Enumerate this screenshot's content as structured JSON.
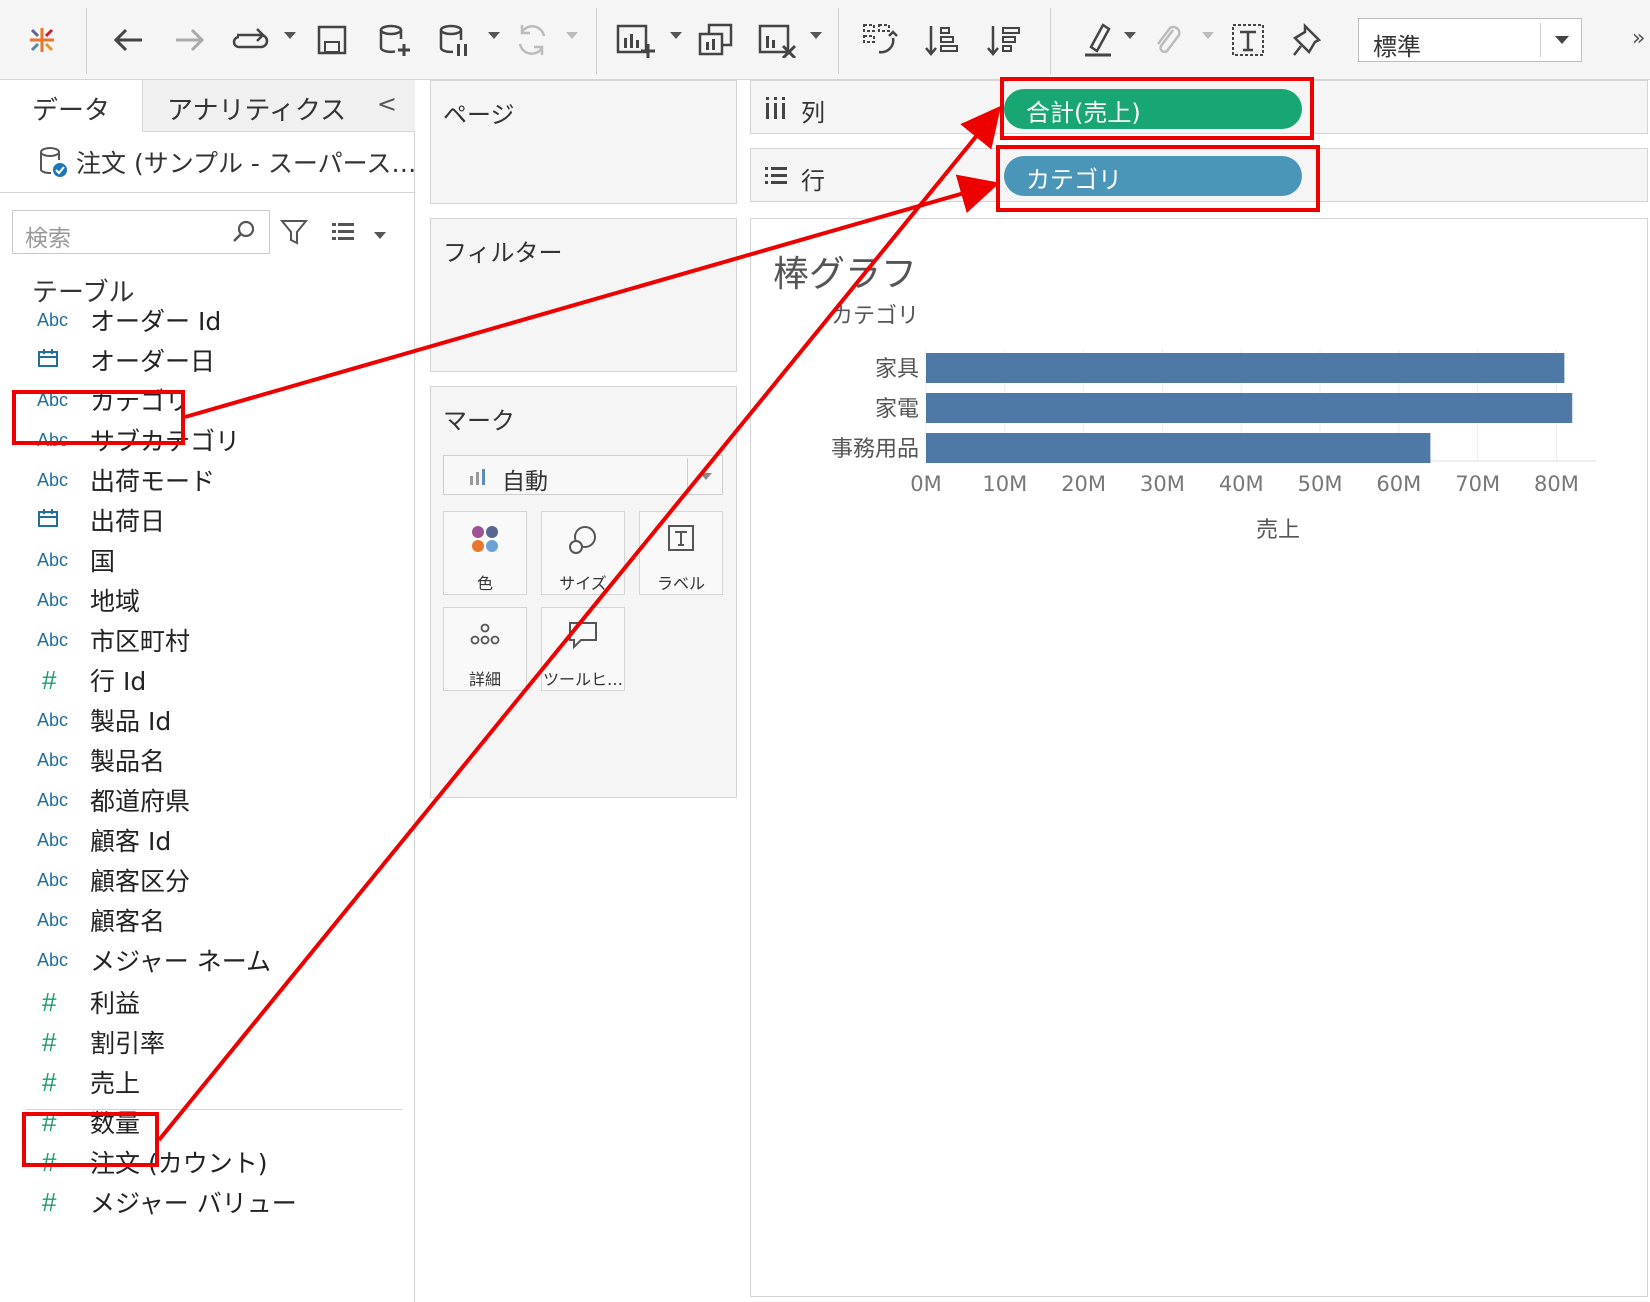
{
  "toolbar": {
    "icons": [
      "tableau-logo-icon",
      "undo-icon",
      "redo-icon",
      "replay-icon",
      "save-icon",
      "new-datasource-icon",
      "pause-autoupdate-icon",
      "refresh-icon",
      "new-worksheet-icon",
      "duplicate-sheet-icon",
      "clear-sheet-icon",
      "swap-rows-columns-icon",
      "sort-ascending-icon",
      "sort-descending-icon",
      "highlight-icon",
      "group-icon",
      "show-labels-icon",
      "fix-axes-icon"
    ],
    "fit_value": "標準",
    "more_glyph": "»"
  },
  "left_pane": {
    "tab_data": "データ",
    "tab_analytics": "アナリティクス",
    "collapse_glyph": "<",
    "datasource": "注文 (サンプル - スーパース…",
    "search_placeholder": "検索",
    "table_heading": "テーブル",
    "dimensions": [
      {
        "type": "Abc",
        "name": "オーダー Id"
      },
      {
        "type": "date",
        "name": "オーダー日"
      },
      {
        "type": "Abc",
        "name": "カテゴリ"
      },
      {
        "type": "Abc",
        "name": "サブカテゴリ"
      },
      {
        "type": "Abc",
        "name": "出荷モード"
      },
      {
        "type": "date",
        "name": "出荷日"
      },
      {
        "type": "Abc",
        "name": "国"
      },
      {
        "type": "Abc",
        "name": "地域"
      },
      {
        "type": "Abc",
        "name": "市区町村"
      },
      {
        "type": "#",
        "name": "行 Id"
      },
      {
        "type": "Abc",
        "name": "製品 Id"
      },
      {
        "type": "Abc",
        "name": "製品名"
      },
      {
        "type": "Abc",
        "name": "都道府県"
      },
      {
        "type": "Abc",
        "name": "顧客 Id"
      },
      {
        "type": "Abc",
        "name": "顧客区分"
      },
      {
        "type": "Abc",
        "name": "顧客名"
      },
      {
        "type": "Abc",
        "name": "メジャー ネーム"
      }
    ],
    "measures": [
      {
        "type": "#",
        "name": "利益"
      },
      {
        "type": "#",
        "name": "割引率"
      },
      {
        "type": "#",
        "name": "売上"
      },
      {
        "type": "#",
        "name": "数量"
      },
      {
        "type": "#",
        "name": "注文 (カウント)"
      },
      {
        "type": "#",
        "name": "メジャー バリュー"
      }
    ]
  },
  "cards": {
    "pages": "ページ",
    "filters": "フィルター",
    "marks": "マーク",
    "mark_type": "自動",
    "mark_buttons": [
      {
        "label": "色",
        "icon": "color-icon"
      },
      {
        "label": "サイズ",
        "icon": "size-icon"
      },
      {
        "label": "ラベル",
        "icon": "label-icon"
      },
      {
        "label": "詳細",
        "icon": "detail-icon"
      },
      {
        "label": "ツールヒ…",
        "icon": "tooltip-icon"
      }
    ]
  },
  "shelves": {
    "columns_label": "列",
    "rows_label": "行",
    "columns_pill": "合計(売上)",
    "rows_pill": "カテゴリ"
  },
  "colors": {
    "bar": "#4e79a7",
    "pill_measure": "#18a773",
    "pill_dimension": "#4a96b9",
    "annotation": "#ee0000"
  },
  "chart_data": {
    "type": "bar",
    "orientation": "horizontal",
    "title": "棒グラフ",
    "row_header": "カテゴリ",
    "categories": [
      "家具",
      "家電",
      "事務用品"
    ],
    "values": [
      81,
      82,
      64
    ],
    "value_unit": "M",
    "xlabel": "売上",
    "xlim": [
      0,
      84
    ],
    "ticks": [
      0,
      10,
      20,
      30,
      40,
      50,
      60,
      70,
      80
    ],
    "tick_labels": [
      "0M",
      "10M",
      "20M",
      "30M",
      "40M",
      "50M",
      "60M",
      "70M",
      "80M"
    ],
    "grid": true
  }
}
